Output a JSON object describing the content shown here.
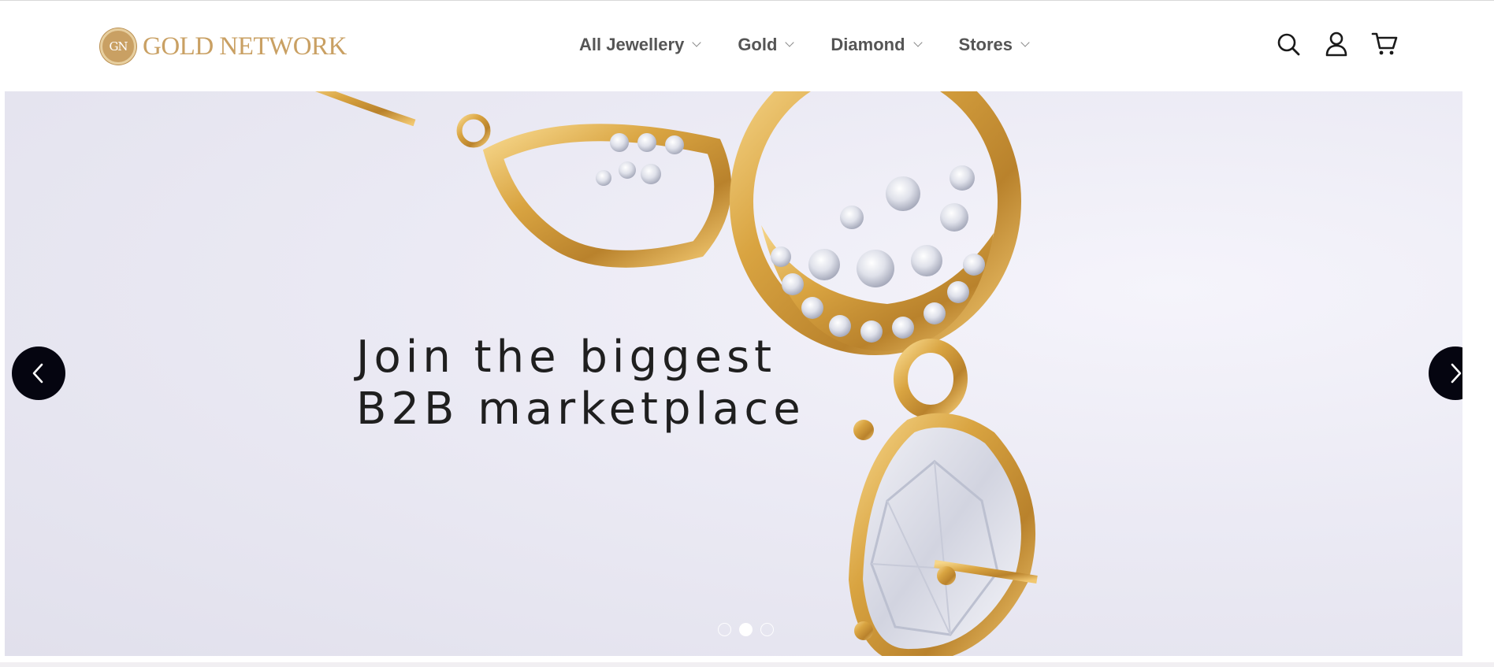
{
  "header": {
    "logo": {
      "badge": "GN",
      "text": "GOLD NETWORK",
      "icon": "gold-network-logo"
    },
    "nav": [
      {
        "label": "All Jewellery",
        "icon": "chevron-down-icon"
      },
      {
        "label": "Gold",
        "icon": "chevron-down-icon"
      },
      {
        "label": "Diamond",
        "icon": "chevron-down-icon"
      },
      {
        "label": "Stores",
        "icon": "chevron-down-icon"
      }
    ],
    "icons": [
      "search-icon",
      "user-icon",
      "cart-icon"
    ]
  },
  "hero": {
    "headline_line1": "Join the biggest",
    "headline_line2": "B2B marketplace",
    "prev_icon": "chevron-left-icon",
    "next_icon": "chevron-right-icon",
    "slides_total": 3,
    "active_slide": 2
  },
  "colors": {
    "brand_gold": "#c9a063",
    "nav_text": "#555555",
    "arrow_bg": "#050510",
    "hero_bg": "#ebeaf4"
  }
}
